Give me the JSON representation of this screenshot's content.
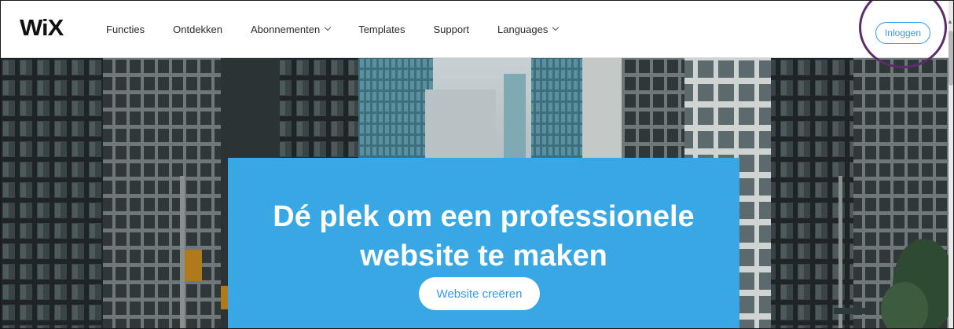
{
  "brand": {
    "logo": "WiX"
  },
  "nav": {
    "items": [
      {
        "label": "Functies",
        "dropdown": false
      },
      {
        "label": "Ontdekken",
        "dropdown": false
      },
      {
        "label": "Abonnementen",
        "dropdown": true
      },
      {
        "label": "Templates",
        "dropdown": false
      },
      {
        "label": "Support",
        "dropdown": false
      },
      {
        "label": "Languages",
        "dropdown": true
      }
    ]
  },
  "header": {
    "login_label": "Inloggen"
  },
  "hero": {
    "title_line1": "Dé plek om een professionele",
    "title_line2": "website te maken",
    "cta_label": "Website creëren"
  },
  "colors": {
    "accent": "#3899ec",
    "hero_card": "#38a7e4",
    "highlight_ring": "#5c2d6b"
  },
  "icons": [
    "chevron-down-icon",
    "scroll-up-arrow-icon"
  ]
}
